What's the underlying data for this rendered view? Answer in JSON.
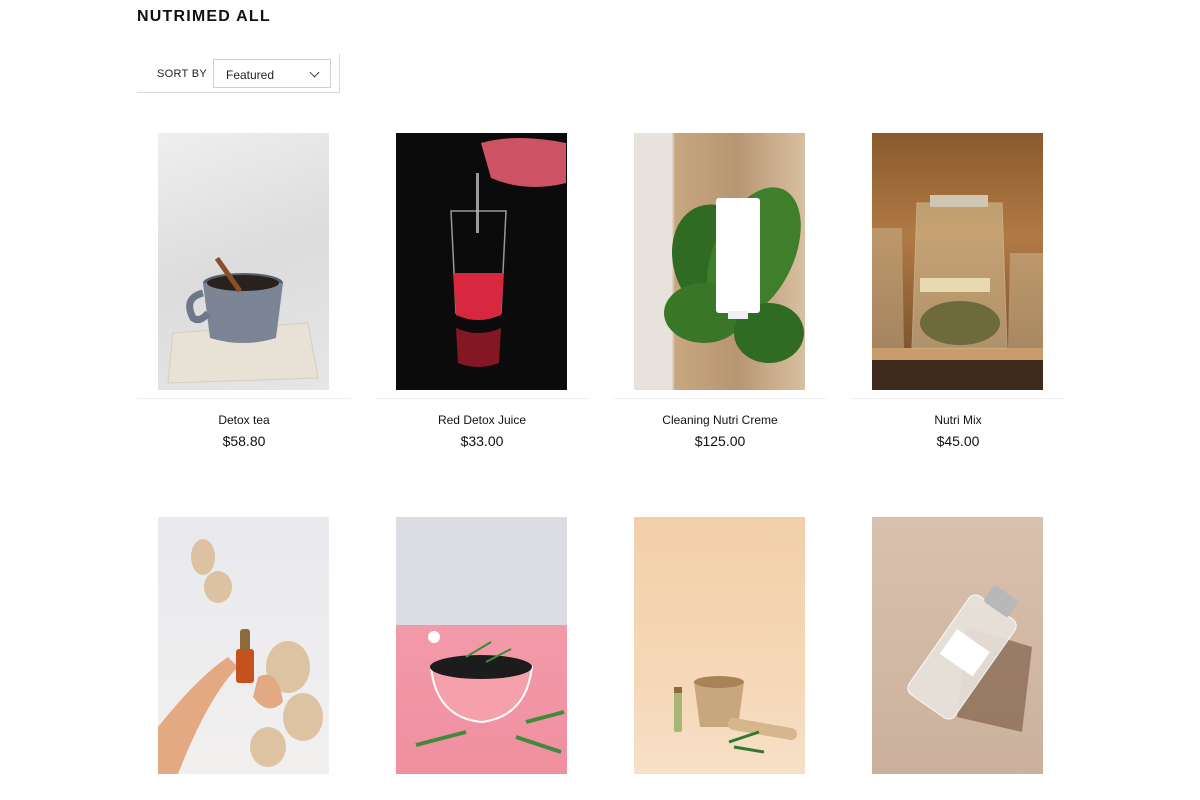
{
  "collection": {
    "title": "NUTRIMED ALL"
  },
  "sort": {
    "label": "SORT BY",
    "selected": "Featured"
  },
  "products": [
    {
      "name": "Detox tea",
      "price": "$58.80",
      "image": "mug-with-cinnamon"
    },
    {
      "name": "Red Detox Juice",
      "price": "$33.00",
      "image": "red-juice-glass"
    },
    {
      "name": "Cleaning Nutri Creme",
      "price": "$125.00",
      "image": "creme-tube-on-leaves"
    },
    {
      "name": "Nutri Mix",
      "price": "$45.00",
      "image": "jars-with-herbs"
    },
    {
      "image": "serum-dropper-bottle"
    },
    {
      "image": "pink-bowl-with-herbs"
    },
    {
      "image": "wooden-mortar"
    },
    {
      "image": "floating-bottle"
    }
  ]
}
